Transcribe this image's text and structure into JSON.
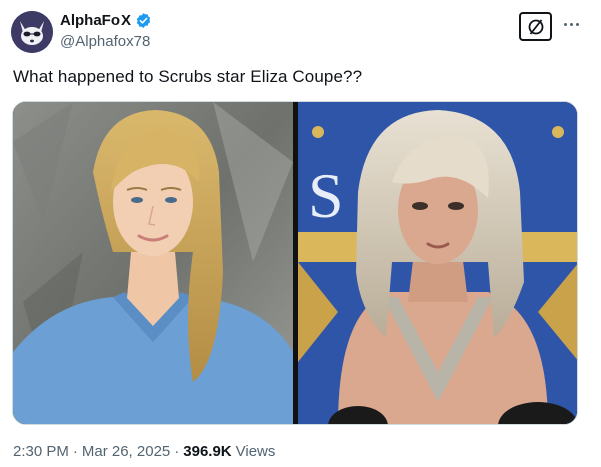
{
  "author": {
    "display_name": "AlphaFo",
    "name_suffix": "X",
    "handle": "@Alphafox78",
    "avatar_icon": "fox-avatar-icon",
    "verified_icon": "verified-badge-icon",
    "verified_color": "#1d9bf0"
  },
  "toolbar": {
    "grok_icon": "grok-icon",
    "more_icon": "more-options-icon"
  },
  "tweet": {
    "text": "What happened to Scrubs star Eliza Coupe??"
  },
  "media": {
    "left_photo": "photo-actress-scrubs",
    "right_photo": "photo-actress-event",
    "right_backdrop_text": "S  NC"
  },
  "meta": {
    "time": "2:30 PM",
    "dot1": "·",
    "date": "Mar 26, 2025",
    "dot2": "·",
    "views_count": "396.9K",
    "views_label": "Views"
  },
  "colors": {
    "text_primary": "#0f1419",
    "text_secondary": "#536471",
    "scrubs_blue": "#6c9fd4",
    "backdrop_blue": "#2f55a8"
  }
}
